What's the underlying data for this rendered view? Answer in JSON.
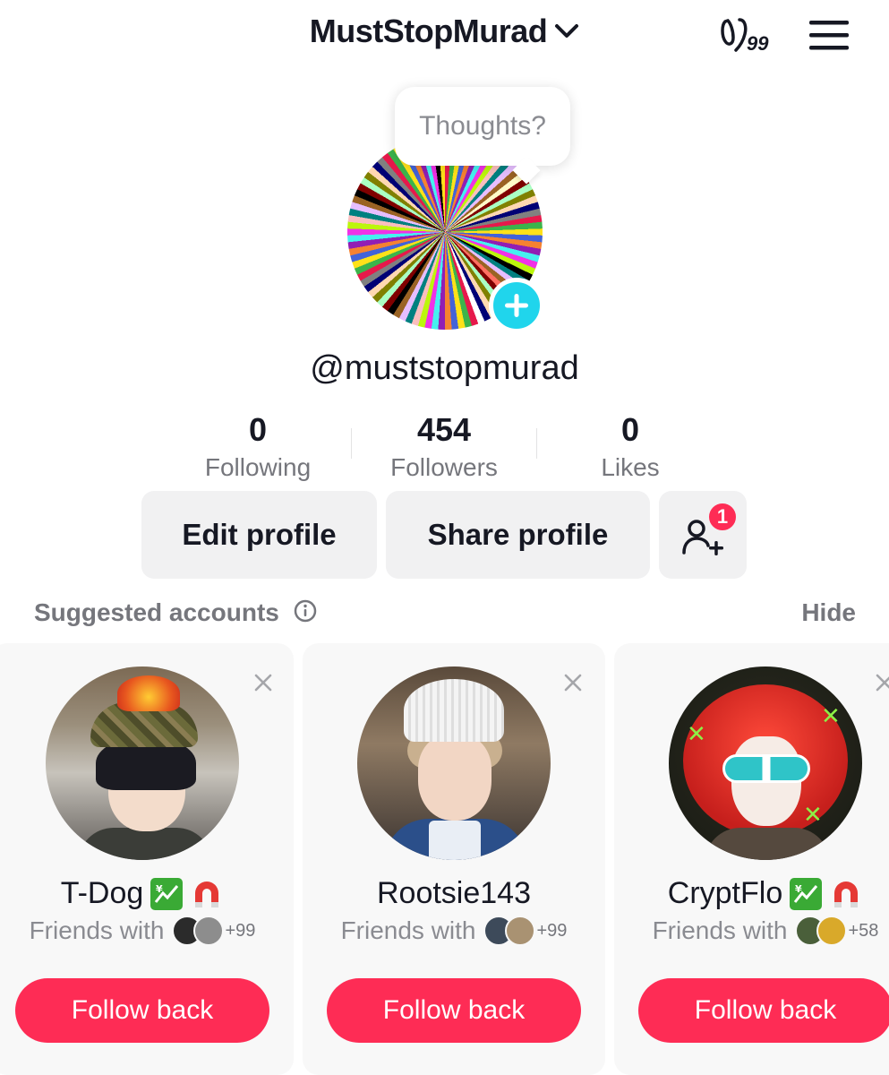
{
  "header": {
    "account_name": "MustStopMurad",
    "creator_badge": "99"
  },
  "profile": {
    "bubble_text": "Thoughts?",
    "handle": "@muststopmurad",
    "stats": [
      {
        "value": "0",
        "label": "Following"
      },
      {
        "value": "454",
        "label": "Followers"
      },
      {
        "value": "0",
        "label": "Likes"
      }
    ],
    "edit_label": "Edit profile",
    "share_label": "Share profile",
    "friend_request_count": "1"
  },
  "suggested": {
    "title": "Suggested accounts",
    "hide_label": "Hide",
    "cards": [
      {
        "name": "T-Dog",
        "friends_text": "Friends with",
        "mutual_count": "+99",
        "button": "Follow back",
        "badges": [
          "chart-yen-icon",
          "magnet-icon"
        ]
      },
      {
        "name": "Rootsie143",
        "friends_text": "Friends with",
        "mutual_count": "+99",
        "button": "Follow back",
        "badges": []
      },
      {
        "name": "CryptFlo",
        "friends_text": "Friends with",
        "mutual_count": "+58",
        "button": "Follow back",
        "badges": [
          "chart-yen-icon",
          "magnet-icon"
        ]
      }
    ]
  },
  "colors": {
    "accent": "#fe2c55",
    "add_button": "#20d5ec",
    "button_bg": "#f1f1f2",
    "card_bg": "#f8f8f8",
    "muted_text": "#75767c"
  }
}
